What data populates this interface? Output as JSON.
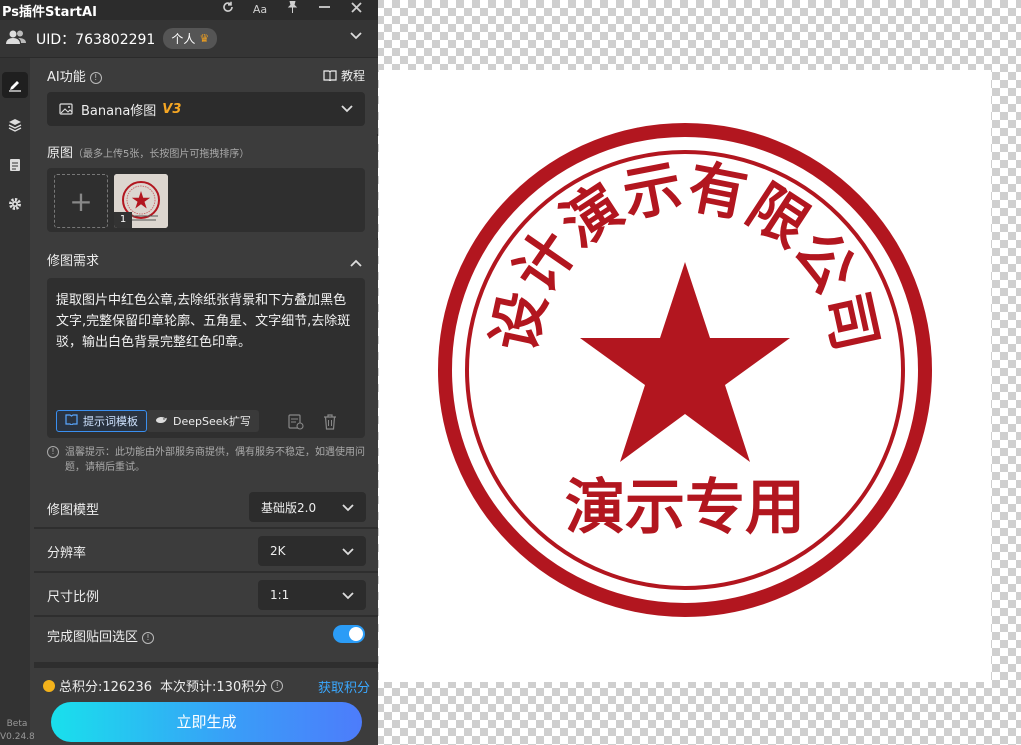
{
  "app": {
    "title": "Ps插件StartAI",
    "beta_label": "Beta",
    "version": "V0.24.8"
  },
  "titlebar_icons": [
    "refresh-icon",
    "font-size-icon",
    "pin-icon",
    "minimize-icon",
    "close-icon"
  ],
  "titlebar_glyphs": {
    "font": "Aa"
  },
  "user": {
    "uid_label": "UID：",
    "uid": "763802291",
    "plan": "个人"
  },
  "ai_feature": {
    "label": "AI功能",
    "tutorial": "教程",
    "model_name": "Banana修图",
    "model_version": "V3"
  },
  "original": {
    "label": "原图",
    "hint": "（最多上传5张，长按图片可拖拽排序）",
    "thumb_index": "1"
  },
  "requirement": {
    "label": "修图需求",
    "prompt": "提取图片中红色公章,去除纸张背景和下方叠加黑色文字,完整保留印章轮廓、五角星、文字细节,去除斑驳，输出白色背景完整红色印章。",
    "template_btn": "提示词模板",
    "deepseek_btn": "DeepSeek扩写",
    "notice": "温馨提示：此功能由外部服务商提供，偶有服务不稳定，如遇使用问题，请稍后重试。"
  },
  "settings": {
    "model_label": "修图模型",
    "model_value": "基础版2.0",
    "resolution_label": "分辨率",
    "resolution_value": "2K",
    "ratio_label": "尺寸比例",
    "ratio_value": "1:1",
    "paste_label": "完成图贴回选区",
    "paste_enabled": true
  },
  "footer": {
    "points_label": "总积分:126236",
    "estimate_label": "本次预计:130积分",
    "get_points": "获取积分",
    "generate": "立即生成"
  },
  "stamp": {
    "company": "设计演示有限公司",
    "bottom": "演示专用",
    "color": "#b2161f"
  },
  "colors": {
    "accent": "#3a9cf8",
    "panel": "#3c3c3c",
    "crown": "#f0a020",
    "v3": "#f5a623"
  }
}
